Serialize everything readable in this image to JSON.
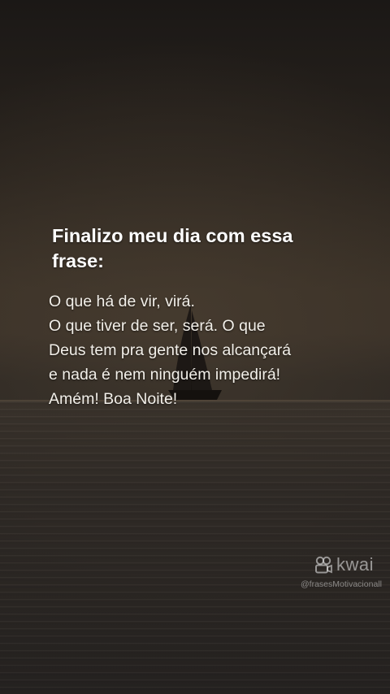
{
  "post": {
    "title": "Finalizo meu dia com essa frase:",
    "lines": [
      "O que há de vir, virá.",
      "O que tiver de ser, será. O que",
      "Deus tem pra gente nos alcançará",
      "e nada é nem ninguém impedirá!",
      "Amém! Boa Noite!"
    ]
  },
  "watermark": {
    "brand": "kwai",
    "icon": "kwai-logo-icon",
    "handle": "@frasesMotivacionall"
  },
  "colors": {
    "text": "#ffffff",
    "background": "#2a2420"
  }
}
